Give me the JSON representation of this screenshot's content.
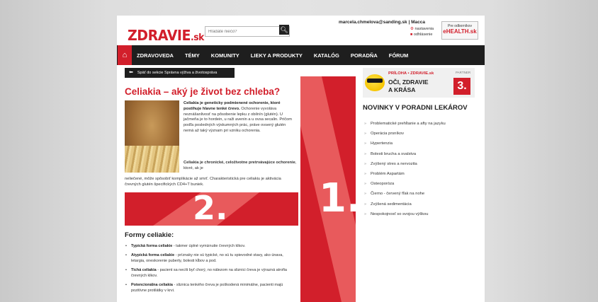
{
  "header": {
    "logo_main": "ZDRAVIE",
    "logo_tld": ".sk",
    "search_placeholder": "Hľadáte niečo?",
    "search_icon": "search-icon",
    "user_email": "marcela.chmelova@sanding.sk | Macca",
    "settings_label": "nastavenia",
    "logout_label": "odhlásenie",
    "partner_top": "Pre odborníkov",
    "partner_name": "eHEALTH.sk"
  },
  "nav": {
    "home_icon": "home-icon",
    "items": [
      "ZDRAVOVEDA",
      "TÉMY",
      "KOMUNITY",
      "LIEKY A PRODUKTY",
      "KATALÓG",
      "PORADŇA",
      "FÓRUM"
    ]
  },
  "back": {
    "label": "Späť do sekcie Správna výživa a životospráva",
    "icon": "arrow-left-icon"
  },
  "article": {
    "title": "Celiakia – aký je život bez chleba?",
    "intro_bold": "Celiakia je geneticky podmienené ochorenie, ktoré postihuje hlavne tenké črevo.",
    "intro_text": " Ochorenie vyvoláva neznášanlivosť na pôsobenie lepku z obilnín (glutén). U jačmeňa je to hordein, u raži avenin a u ovsa secalin. Pričom podľa posledných výskumných prác, práve ovsený glutén nemá až taký význam pri vzniku ochorenia.",
    "intro2_bold": "Celiakia je chronické, celoživotne pretrvávajúce ochorenie",
    "intro2_text": ", ktoré, ak je",
    "intro3_text": "neliečené, môže spôsobiť komplikácie až smrť. Charakteristická pre celiakiu je aktivácia črevných glutén špecifických CD4+T buniek.",
    "banner_number": "2.",
    "forms_title": "Formy celiakie:",
    "forms": [
      {
        "name": "Typická forma celiakie",
        "text": " - takmer úplné vymiznutie črevných klkov."
      },
      {
        "name": "Atypická forma celiakie",
        "text": " - príznaky nie sú typické, no sú tu spievodné stavy, ako únava, letargia, oneskorenie puberty, bolesti kĺbov a pod."
      },
      {
        "name": "Tichá celiakia",
        "text": " - pacient sa necíti byť chorý, no nálezom na sliznici čreva je výrazná atrofia črevných klkov."
      },
      {
        "name": "Potencionálna celiakia",
        "text": " - sliznica tenkého čreva je poškodená minimálne, pacienti majú pozitívne protilátky v krvi."
      }
    ]
  },
  "center_banner_number": "1.",
  "sidebar": {
    "promo_top": "PRÍLOHA • ZDRAVIE.sk",
    "promo_line1": "OČI, ZDRAVIE",
    "promo_line2": "A KRÁSA",
    "promo_partner": "PARTNER",
    "promo_number": "3.",
    "title": "NOVINKY V PORADNI LEKÁROV",
    "items": [
      "Problematické prehĺtanie a afty na jazyku",
      "Operácia prsníkov",
      "Hypertenzia",
      "Bolesti brucha a svalstva",
      "Zvýšený stres a nervozita",
      "Problém Aspartám",
      "Osteoporóza",
      "Čierno - červený fľak na nohe",
      "Zvýšená sedimentácia",
      "Nespokojnosť so svojou výškou"
    ]
  },
  "colors": {
    "accent": "#d21f2b",
    "accent_light": "#e85a5c",
    "nav_bg": "#1e1e1e"
  }
}
